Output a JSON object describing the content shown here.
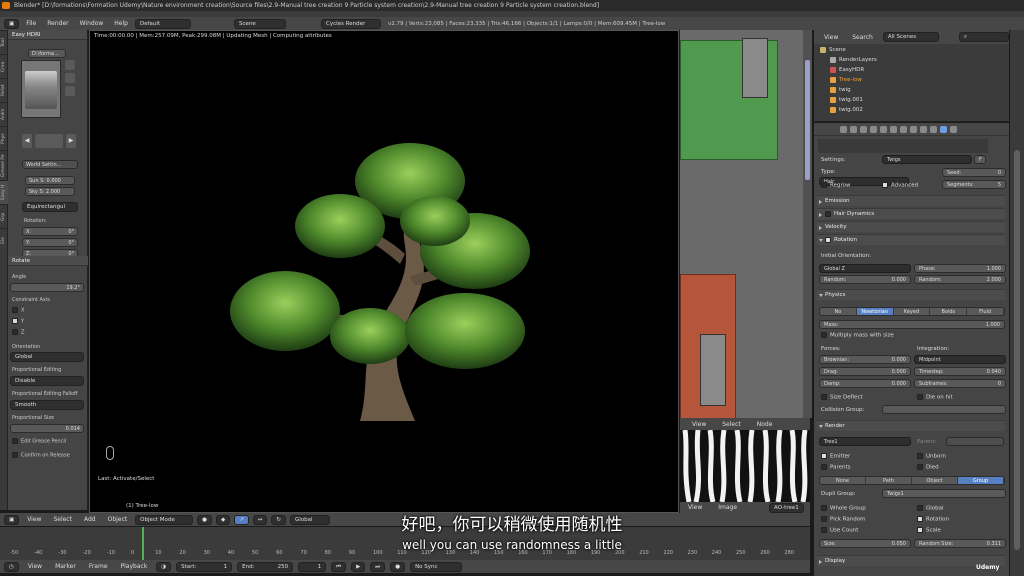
{
  "window": {
    "title": "Blender* [D:\\formations\\Formation Udemy\\Nature environment creation\\Source files\\2.9-Manual tree creation 9 Particle system creation\\2.9-Manual tree creation 9 Particle system creation.blend]"
  },
  "menubar": {
    "items": [
      "File",
      "Render",
      "Window",
      "Help"
    ],
    "layout": "Default",
    "scene": "Scene",
    "engine": "Cycles Render",
    "stats": "v2.79 | Verts:23,085 | Faces:23,335 | Tris:46,166 | Objects:1/1 | Lamps:0/0 | Mem:609.45M | Tree-low"
  },
  "left_tabs": [
    "Tool",
    "Crea",
    "Relat",
    "Anim",
    "Phys",
    "Grease Pe",
    "Easy H",
    "Grp",
    "Ele"
  ],
  "tool_shelf": {
    "easy_hdri": "Easy HDRI",
    "file": "D:\\forma...",
    "world_settings": "World Settin...",
    "sun": "Sun S: 0.000",
    "sky": "Sky S: 2.000",
    "mapping": "Equirectangul",
    "rotation_label": "Rotation:",
    "rot_x": "X:",
    "rot_x_val": "0°",
    "rot_y": "Y:",
    "rot_y_val": "0°",
    "rot_z": "Z:",
    "rot_z_val": "0°",
    "rotate_header": "Rotate",
    "angle_label": "Angle",
    "angle_value": "19.2°",
    "constraint_axis": "Constraint Axis",
    "axis_x": "X",
    "axis_y": "Y",
    "axis_z": "Z",
    "orientation_label": "Orientation",
    "orientation_value": "Global",
    "prop_edit_label": "Proportional Editing",
    "prop_edit_value": "Disable",
    "falloff_label": "Proportional Editing Falloff",
    "falloff_value": "Smooth",
    "prop_size_label": "Proportional Size",
    "prop_size_value": "0.014",
    "edit_grease": "Edit Grease Pencil",
    "confirm_release": "Confirm on Release"
  },
  "viewport": {
    "info": "Time:00:00.00 | Mem:257.09M, Peak:299.08M | Updating Mesh | Computing attributes",
    "last_op": "Last: Activate/Select",
    "object_name": "(1) Tree-low"
  },
  "outliner": {
    "view": "View",
    "search": "Search",
    "scenes": "All Scenes",
    "items": [
      "Scene",
      "RenderLayers",
      "EasyHDR",
      "Tree-low",
      "twig",
      "twig.001",
      "twig.002"
    ]
  },
  "properties": {
    "settings_label": "Settings:",
    "settings_value": "Twigs",
    "settings_f": "F",
    "type_label": "Type:",
    "type_value": "Hair",
    "seed_label": "Seed:",
    "seed_value": "0",
    "regrow": "Regrow",
    "advanced": "Advanced",
    "segments_label": "Segments:",
    "segments_value": "5",
    "emission": "Emission",
    "hair_dynamics": "Hair Dynamics",
    "velocity": "Velocity",
    "rotation": "Rotation",
    "initial_orientation": "Initial Orientation:",
    "orient_value": "Global Z",
    "random_label": "Random:",
    "random_value": "0.000",
    "phase_label": "Phase:",
    "phase_value": "1.000",
    "random2_label": "Random:",
    "random2_value": "2.000",
    "physics": "Physics",
    "physics_modes": [
      "No",
      "Newtonian",
      "Keyed",
      "Boids",
      "Fluid"
    ],
    "mass_label": "Mass:",
    "mass_value": "1.000",
    "multiply_mass": "Multiply mass with size",
    "forces": "Forces:",
    "integration": "Integration:",
    "brownian_label": "Brownian:",
    "brownian_value": "0.000",
    "integration_value": "Midpoint",
    "drag_label": "Drag:",
    "drag_value": "0.000",
    "timestep_label": "Timestep:",
    "timestep_value": "0.040",
    "damp_label": "Damp:",
    "damp_value": "0.000",
    "subframes_label": "Subframes:",
    "subframes_value": "0",
    "size_deflect": "Size Deflect",
    "die_on_hit": "Die on hit",
    "collision_group": "Collision Group:",
    "render": "Render",
    "material": "Tree1",
    "parent_label": "Parent:",
    "emitter": "Emitter",
    "unborn": "Unborn",
    "parents": "Parents",
    "died": "Died",
    "render_modes": [
      "None",
      "Path",
      "Object",
      "Group"
    ],
    "dupli_group_label": "Dupli Group:",
    "dupli_group_value": "Twigs1",
    "whole_group": "Whole Group",
    "global": "Global",
    "pick_random": "Pick Random",
    "rotation_chk": "Rotation",
    "use_count": "Use Count",
    "scale_chk": "Scale",
    "size_label": "Size:",
    "size_value": "0.050",
    "random_size_label": "Random Size:",
    "random_size_value": "0.311",
    "display": "Display"
  },
  "image_editor": {
    "menus": [
      "View",
      "Select",
      "Node"
    ],
    "menus2": [
      "View",
      "Image"
    ],
    "image_name": "AO-tree1"
  },
  "viewport_header": {
    "menus": [
      "View",
      "Select",
      "Add",
      "Object"
    ],
    "mode": "Object Mode",
    "orientation": "Global"
  },
  "timeline": {
    "ticks": [
      "-50",
      "-40",
      "-30",
      "-20",
      "-10",
      "0",
      "10",
      "20",
      "30",
      "40",
      "50",
      "60",
      "70",
      "80",
      "90",
      "100",
      "110",
      "120",
      "130",
      "140",
      "150",
      "160",
      "170",
      "180",
      "190",
      "200",
      "210",
      "220",
      "230",
      "240",
      "250",
      "260",
      "280"
    ],
    "menus": [
      "View",
      "Marker",
      "Frame",
      "Playback"
    ],
    "start": "Start:",
    "start_value": "1",
    "end": "End:",
    "end_value": "250",
    "current": "1",
    "sync": "No Sync"
  },
  "subtitles": {
    "chinese": "好吧，你可以稍微使用随机性",
    "english": "well you can use randomness a little"
  },
  "watermark": "Udemy"
}
